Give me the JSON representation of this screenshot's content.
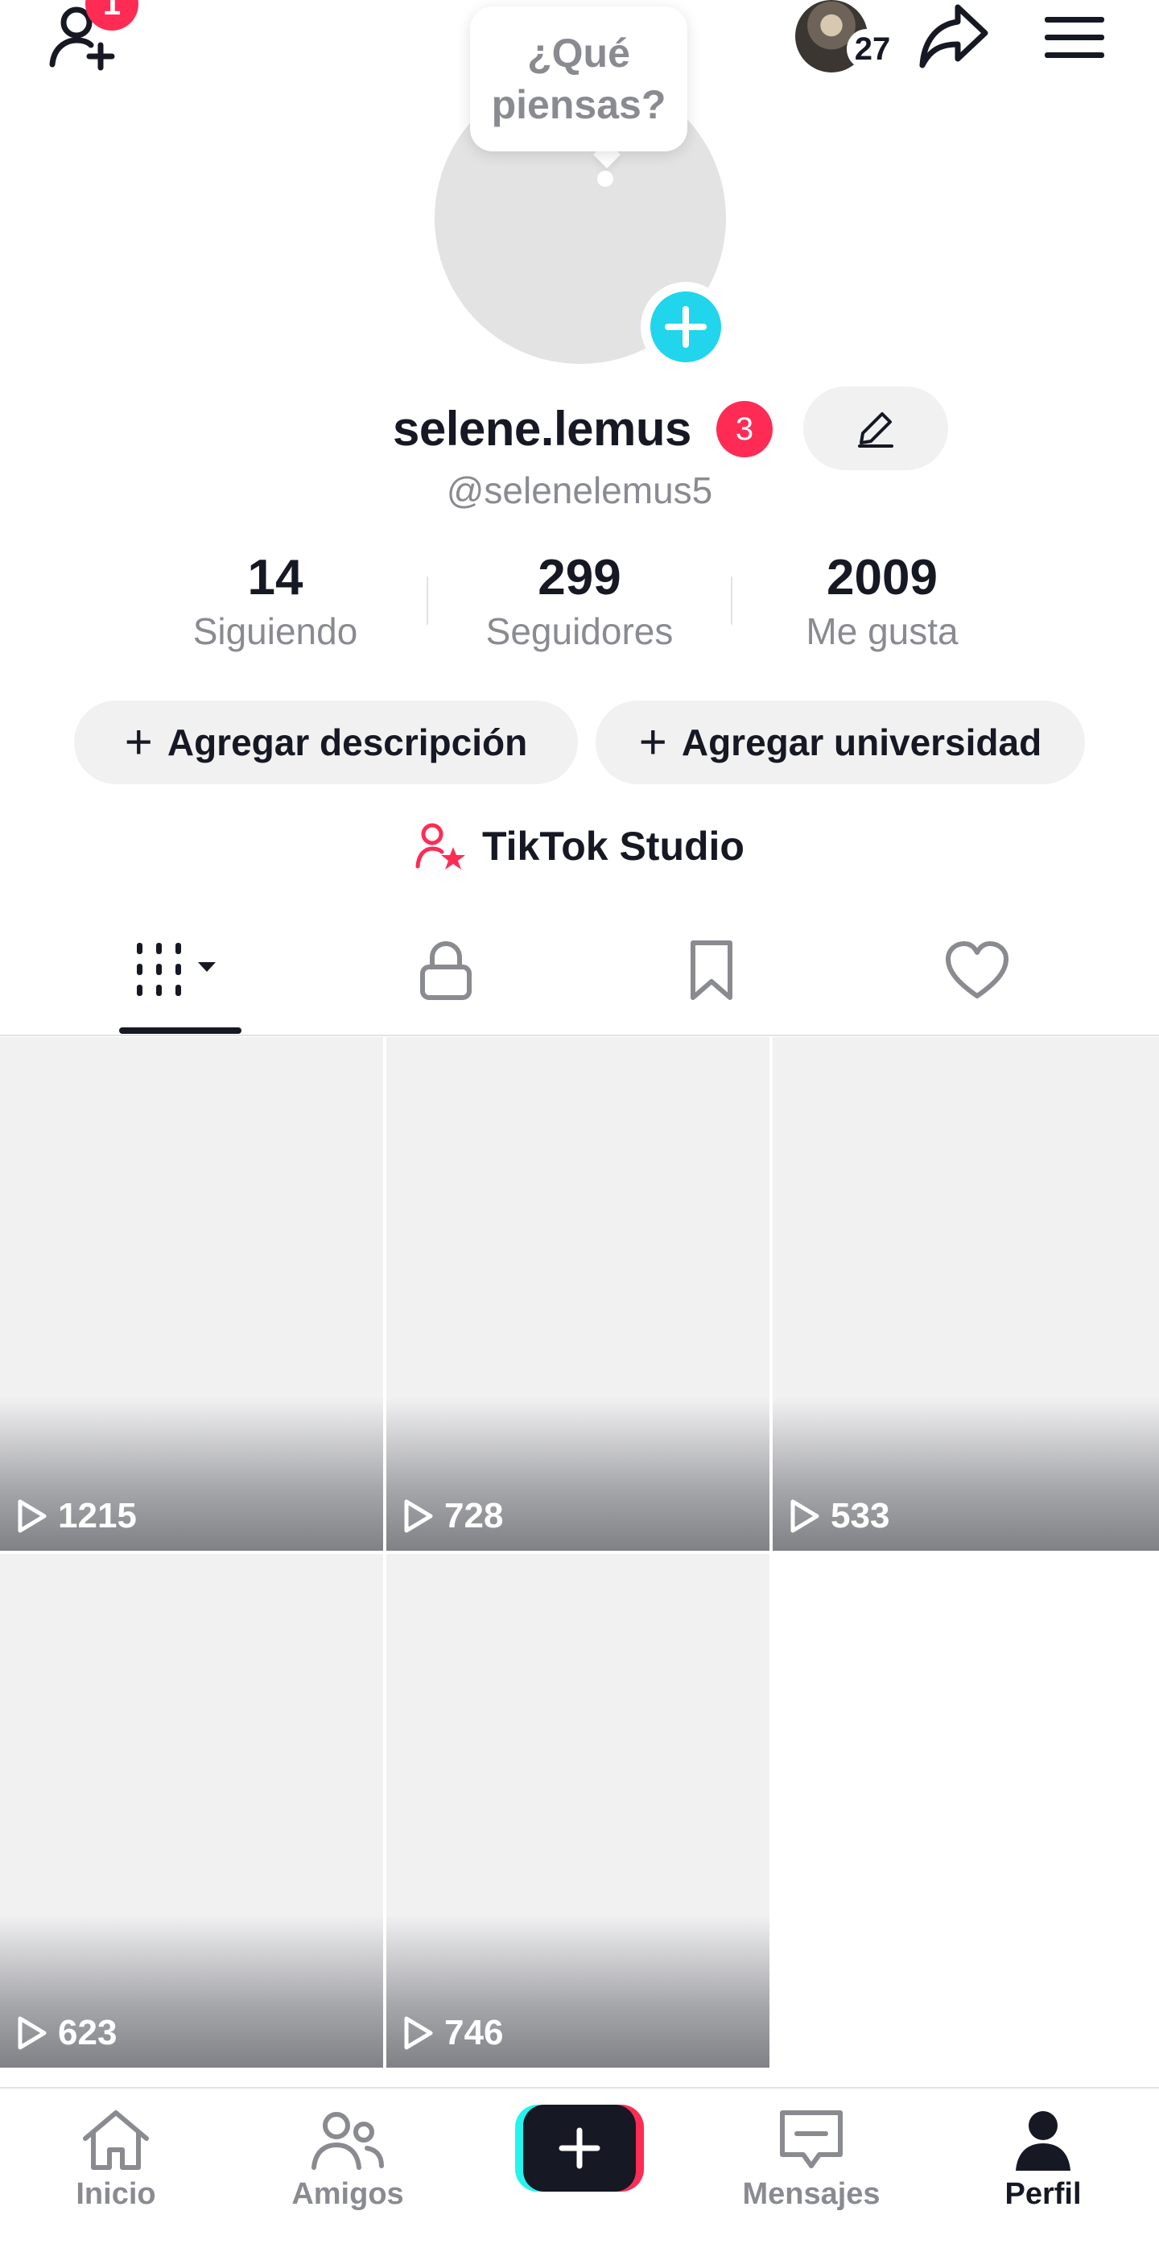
{
  "top_bar": {
    "add_friends_badge": "1",
    "story_count": "27"
  },
  "avatar": {
    "bubble_text": "¿Qué piensas?"
  },
  "profile": {
    "name": "selene.lemus",
    "name_badge": "3",
    "handle": "@selenelemus5"
  },
  "stats": [
    {
      "value": "14",
      "label": "Siguiendo"
    },
    {
      "value": "299",
      "label": "Seguidores"
    },
    {
      "value": "2009",
      "label": "Me gusta"
    }
  ],
  "actions": {
    "add_description": "Agregar descripción",
    "add_university": "Agregar universidad",
    "plus_glyph": "+"
  },
  "studio": {
    "label": "TikTok Studio"
  },
  "tabs": [
    {
      "icon": "videos-grid-icon",
      "active": true
    },
    {
      "icon": "lock-icon",
      "active": false
    },
    {
      "icon": "bookmark-icon",
      "active": false
    },
    {
      "icon": "heart-icon",
      "active": false
    }
  ],
  "videos": [
    {
      "views": "1215"
    },
    {
      "views": "728"
    },
    {
      "views": "533"
    },
    {
      "views": "623"
    },
    {
      "views": "746"
    }
  ],
  "bottom_nav": [
    {
      "label": "Inicio",
      "icon": "home-icon"
    },
    {
      "label": "Amigos",
      "icon": "friends-icon"
    },
    {
      "label": "",
      "icon": "create-icon"
    },
    {
      "label": "Mensajes",
      "icon": "messages-icon"
    },
    {
      "label": "Perfil",
      "icon": "profile-icon",
      "active": true
    }
  ],
  "colors": {
    "accent_red": "#fe2c55",
    "accent_cyan": "#25f4ee",
    "plus_blue": "#20d5ec",
    "text_primary": "#161823",
    "text_secondary": "#8a8b91"
  }
}
